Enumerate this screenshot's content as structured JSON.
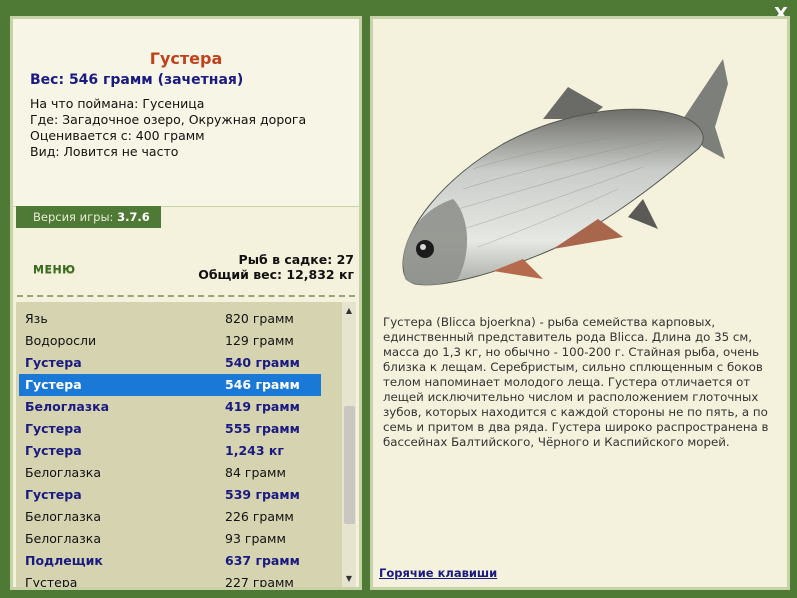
{
  "close": "X",
  "info": {
    "title": "Густера",
    "weight": "Вес: 546 грамм (зачетная)",
    "lines": [
      "На что поймана: Гусеница",
      "Где: Загадочное озеро, Окружная дорога",
      "Оценивается с: 400 грамм",
      "Вид: Ловится не часто"
    ]
  },
  "version": {
    "label": "Версия игры:",
    "value": "3.7.6"
  },
  "menu_label": "МЕНЮ",
  "cage": {
    "count": "Рыб в садке: 27",
    "total": "Общий вес: 12,832 кг"
  },
  "catch_list": [
    {
      "name": "Язь",
      "weight": "820 грамм",
      "style": "normal"
    },
    {
      "name": "Водоросли",
      "weight": "129 грамм",
      "style": "normal"
    },
    {
      "name": "Густера",
      "weight": "540 грамм",
      "style": "bold"
    },
    {
      "name": "Густера",
      "weight": "546 грамм",
      "style": "selected"
    },
    {
      "name": "Белоглазка",
      "weight": "419 грамм",
      "style": "bold"
    },
    {
      "name": "Густера",
      "weight": "555 грамм",
      "style": "bold"
    },
    {
      "name": "Густера",
      "weight": "1,243 кг",
      "style": "bold"
    },
    {
      "name": "Белоглазка",
      "weight": "84 грамм",
      "style": "normal"
    },
    {
      "name": "Густера",
      "weight": "539 грамм",
      "style": "bold"
    },
    {
      "name": "Белоглазка",
      "weight": "226 грамм",
      "style": "normal"
    },
    {
      "name": "Белоглазка",
      "weight": "93 грамм",
      "style": "normal"
    },
    {
      "name": "Подлещик",
      "weight": "637 грамм",
      "style": "bold"
    },
    {
      "name": "Густера",
      "weight": "227 грамм",
      "style": "normal"
    }
  ],
  "description": "Густера (Blicca bjoerkna) - рыба семейства карповых, единственный представитель рода Blicca. Длина до 35 см, масса до 1,3 кг, но обычно - 100-200 г. Стайная рыба, очень близка к лещам. Серебристым, сильно сплющенным с боков телом напоминает молодого леща. Густера отличается от лещей исключительно числом и расположением глоточных зубов, которых находится с каждой стороны не по пять, а по семь и притом в два ряда. Густера широко распространена в бассейнах Балтийского, Чёрного и Каспийского морей.",
  "hotkeys": "Горячие клавиши",
  "colors": {
    "background": "#4e7a35",
    "panel": "#f4f1dc",
    "list": "#d6d4b0",
    "selected": "#1a78d6",
    "title": "#c0421c"
  }
}
